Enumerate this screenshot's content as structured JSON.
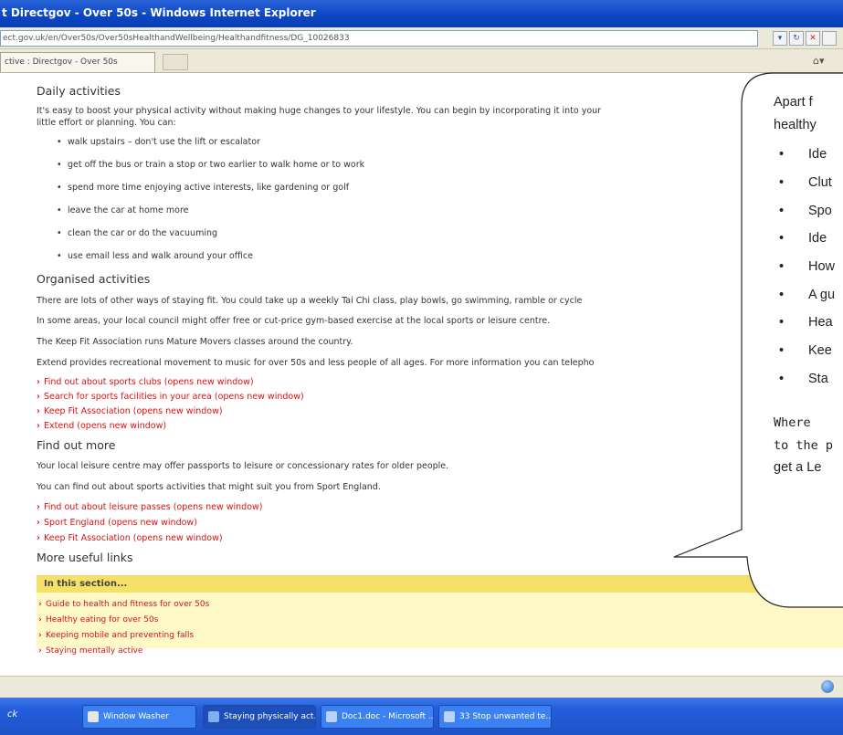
{
  "window": {
    "title": "t Directgov - Over 50s - Windows Internet Explorer",
    "address": "ect.gov.uk/en/Over50s/Over50sHealthandWellbeing/Healthandfitness/DG_10026833",
    "tab_label": "ctive : Directgov - Over 50s"
  },
  "page": {
    "sections": [
      {
        "heading": "Daily activities",
        "paragraphs": [
          "It's easy to boost your physical activity without making huge changes to your lifestyle. You can begin by incorporating it into your",
          "little effort or planning. You can:"
        ],
        "bullets": [
          "walk upstairs – don't use the lift or escalator",
          "get off the bus or train a stop or two earlier to walk home or to work",
          "spend more time enjoying active interests, like gardening or golf",
          "leave the car at home more",
          "clean the car or do the vacuuming",
          "use email less and walk around your office"
        ]
      },
      {
        "heading": "Organised activities",
        "paragraphs": [
          "There are lots of other ways of staying fit. You could take up a weekly Tai Chi class, play bowls, go swimming, ramble or cycle",
          "In some areas, your local council might offer free or cut-price gym-based exercise at the local sports or leisure centre.",
          "The Keep Fit Association runs Mature Movers classes around the country.",
          "Extend provides recreational movement to music for over 50s and less people of all ages. For more information you can telepho"
        ],
        "links": [
          "Find out about sports clubs (opens new window)",
          "Search for sports facilities in your area (opens new window)",
          "Keep Fit Association (opens new window)",
          "Extend (opens new window)"
        ]
      },
      {
        "heading": "Find out more",
        "paragraphs": [
          "Your local leisure centre may offer passports to leisure or concessionary rates for older people.",
          "You can find out about sports activities that might suit you from Sport England."
        ],
        "links": [
          "Find out about leisure passes (opens new window)",
          "Sport England (opens new window)",
          "Keep Fit Association (opens new window)"
        ]
      },
      {
        "heading": "More useful links"
      }
    ],
    "in_this_section": {
      "heading": "In this section...",
      "links": [
        "Guide to health and fitness for over 50s",
        "Healthy eating for over 50s",
        "Keeping mobile and preventing falls",
        "Staying mentally active"
      ]
    }
  },
  "bubble": {
    "line1": "Apart f",
    "line2": "healthy",
    "bullets": [
      "Ide",
      "Clut",
      "Spo",
      "Ide",
      "How",
      "A gu",
      "Hea",
      "Kee",
      "Sta"
    ],
    "line3": "Where",
    "line4": "to the p",
    "line5": "get a Le"
  },
  "taskbar": {
    "start_label": "ck",
    "items": [
      "Window Washer",
      "Staying physically act...",
      "Doc1.doc - Microsoft ...",
      "33 Stop unwanted te..."
    ]
  }
}
